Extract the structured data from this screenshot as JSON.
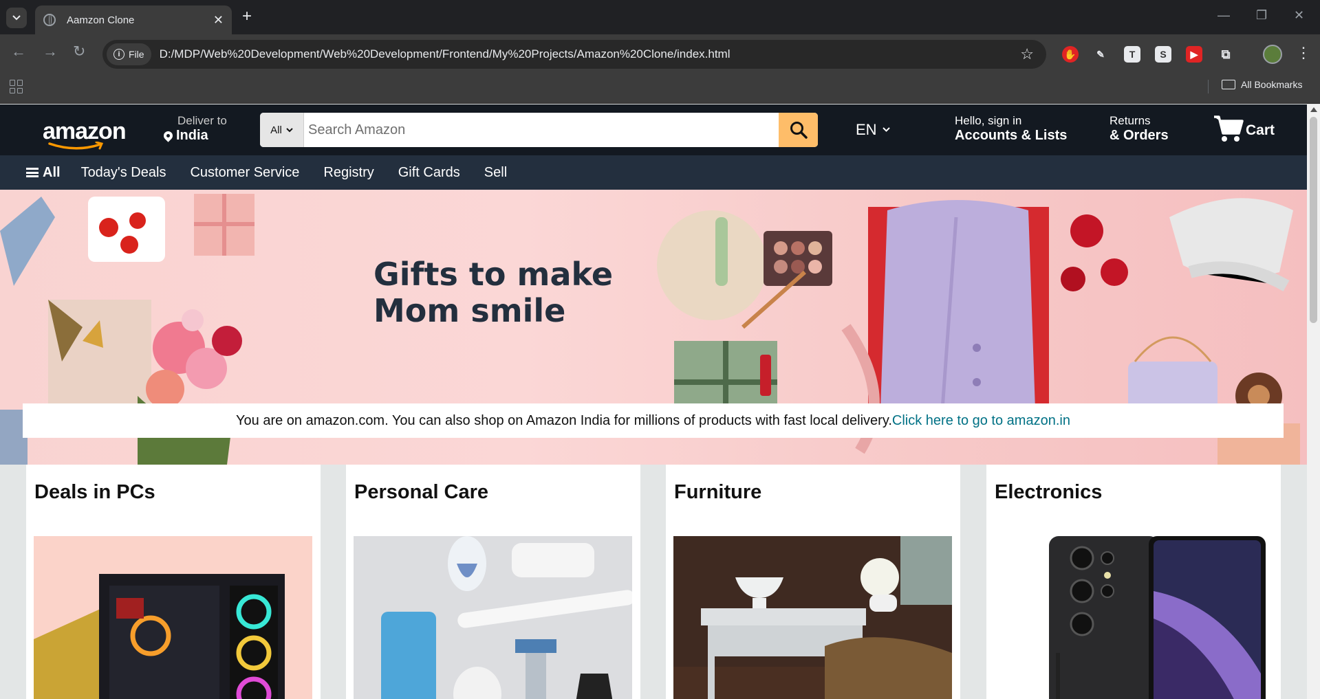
{
  "browser": {
    "tab_title": "Aamzon Clone",
    "chip_label": "File",
    "url": "D:/MDP/Web%20Development/Web%20Development/Frontend/My%20Projects/Amazon%20Clone/index.html",
    "bookmarks_label": "All Bookmarks"
  },
  "header": {
    "logo_text": "amazon",
    "deliver_line1": "Deliver to",
    "deliver_location": "India",
    "search": {
      "category": "All",
      "placeholder": "Search Amazon"
    },
    "language": "EN",
    "account_line1": "Hello, sign in",
    "account_line2": "Accounts & Lists",
    "returns_line1": "Returns",
    "returns_line2": "& Orders",
    "cart_label": "Cart"
  },
  "subnav": {
    "all_label": "All",
    "items": [
      "Today's Deals",
      "Customer Service",
      "Registry",
      "Gift Cards",
      "Sell"
    ]
  },
  "hero": {
    "title_line1": "Gifts to make",
    "title_line2": "Mom smile",
    "notice_text": "You are on amazon.com. You can also shop on Amazon India for millions of products with fast local delivery.",
    "notice_link": "Click here to go to amazon.in"
  },
  "cards": [
    {
      "title": "Deals in PCs"
    },
    {
      "title": "Personal Care"
    },
    {
      "title": "Furniture"
    },
    {
      "title": "Electronics"
    }
  ],
  "colors": {
    "nav_bg": "#131921",
    "subnav_bg": "#232f3e",
    "search_btn": "#febd69",
    "link": "#007185",
    "accent": "#ff9900"
  }
}
